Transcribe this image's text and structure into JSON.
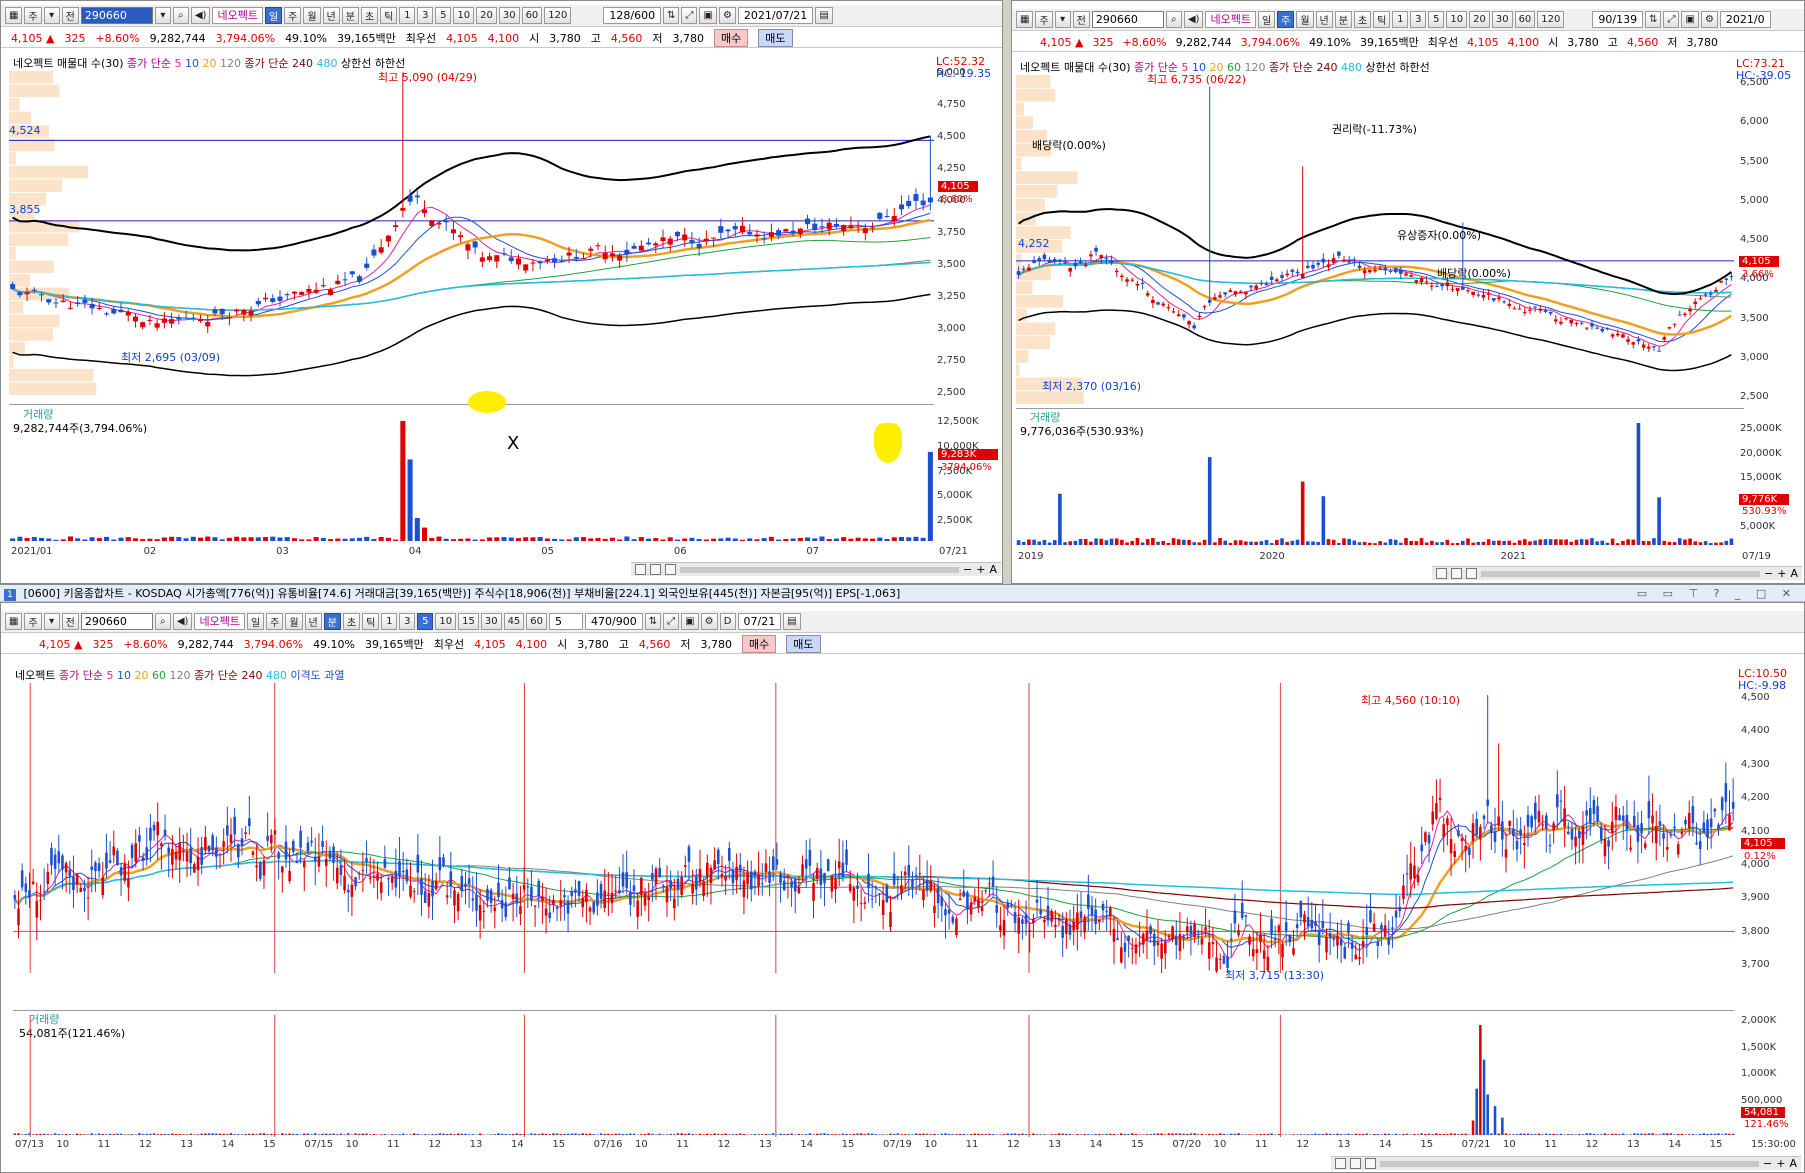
{
  "toolbar": {
    "type_btn": "주",
    "mode_btn": "전",
    "code": "290660",
    "stock_name": "네오펙트",
    "period_tabs": [
      "일",
      "주",
      "월",
      "년",
      "분",
      "초",
      "틱"
    ],
    "numbers": [
      "1",
      "3",
      "5",
      "10",
      "20",
      "30",
      "60",
      "120"
    ],
    "min_numbers": [
      "1",
      "3",
      "5",
      "10",
      "15",
      "30",
      "45",
      "60"
    ]
  },
  "quote": {
    "price": "4,105",
    "arrow": "▲",
    "change": "325",
    "pct": "+8.60%",
    "volume": "9,282,744",
    "vol_pct": "3,794.06%",
    "turnover": "49.10%",
    "amount": "39,165백만",
    "best_label": "최우선",
    "best_ask": "4,105",
    "best_bid": "4,100",
    "open_label": "시",
    "open": "3,780",
    "high_label": "고",
    "high": "4,560",
    "low_label": "저",
    "low": "3,780",
    "buy": "매수",
    "sell": "매도"
  },
  "panel_daily": {
    "count": "128/600",
    "date": "2021/07/21",
    "legend": {
      "title": "네오펙트 매물대 수(30)",
      "ma": "종가 단순",
      "ma5": "5",
      "ma10": "10",
      "ma20": "20",
      "ma120": "120",
      "ma240_label": "종가 단순 240",
      "ma480": "480",
      "upper": "상한선",
      "lower": "하한선"
    },
    "lc": "LC:52.32",
    "hc": "HC:-19.35",
    "high_note": "최고 5,090 (04/29)",
    "low_note": "최저 2,695 (03/09)",
    "hline1": "4,524",
    "hline2": "3,855",
    "price_tag": "4,105",
    "pct_tag": "8.60%",
    "y_labels": [
      "5,000",
      "4,750",
      "4,500",
      "4,250",
      "4,000",
      "3,750",
      "3,500",
      "3,250",
      "3,000",
      "2,750",
      "2,500"
    ],
    "vol_title": "거래량",
    "vol_value": "9,282,744주(3,794.06%)",
    "vol_tag": "9,283K",
    "vol_pct_tag": "3794.06%",
    "mark_x": "X",
    "vol_labels": [
      "12,500K",
      "10,000K",
      "7,500K",
      "5,000K",
      "2,500K"
    ],
    "x_labels": [
      "2021/01",
      "02",
      "03",
      "04",
      "05",
      "06",
      "07",
      "07/21"
    ]
  },
  "panel_weekly": {
    "count": "90/139",
    "date": "2021/0",
    "legend": {
      "title": "네오펙트 매물대 수(30)",
      "ma": "종가 단순",
      "ma5": "5",
      "ma10": "10",
      "ma20": "20",
      "ma60": "60",
      "ma120": "120",
      "ma240_label": "종가 단순 240",
      "ma480": "480",
      "upper": "상한선",
      "lower": "하한선"
    },
    "lc": "LC:73.21",
    "hc": "HC:-39.05",
    "high_note": "최고 6,735 (06/22)",
    "low_note": "최저 2,370 (03/16)",
    "events": [
      "배당락(0.00%)",
      "권리락(-11.73%)",
      "유상증자(0.00%)",
      "배당락(0.00%)"
    ],
    "hline": "4,252",
    "price_tag": "4,105",
    "pct_tag": "3.66%",
    "y_labels": [
      "6,500",
      "6,000",
      "5,500",
      "5,000",
      "4,500",
      "4,000",
      "3,500",
      "3,000",
      "2,500"
    ],
    "vol_title": "거래량",
    "vol_value": "9,776,036주(530.93%)",
    "vol_tag": "9,776K",
    "vol_pct_tag": "530.93%",
    "vol_labels": [
      "25,000K",
      "20,000K",
      "15,000K",
      "10,000K",
      "5,000K"
    ],
    "x_labels": [
      "2019",
      "2020",
      "2021",
      "07/19"
    ]
  },
  "main_header": "[0600] 키움종합차트 - KOSDAQ 시가총액[776(억)] 유통비율[74.6] 거래대금[39,165(백만)] 주식수[18,906(천)] 부채비율[224.1] 외국인보유[445(천)] 자본금[95(억)] EPS[-1,063]",
  "panel_minute": {
    "count": "470/900",
    "min_sel": "5",
    "date": "07/21",
    "d_label": "D",
    "legend": {
      "title": "네오펙트",
      "ma": "종가 단순",
      "ma5": "5",
      "ma10": "10",
      "ma20": "20",
      "ma60": "60",
      "ma120": "120",
      "ma240_label": "종가 단순 240",
      "ma480": "480",
      "disp": "이격도 과열"
    },
    "lc": "LC:10.50",
    "hc": "HC:-9.98",
    "high_note": "최고 4,560 (10:10)",
    "low_note": "최저 3,715 (13:30)",
    "price_tag": "4,105",
    "pct_tag": "0.12%",
    "y_labels": [
      "4,500",
      "4,400",
      "4,300",
      "4,200",
      "4,100",
      "4,000",
      "3,900",
      "3,800",
      "3,700"
    ],
    "vol_title": "거래량",
    "vol_value": "54,081주(121.46%)",
    "vol_tag": "54,081",
    "vol_pct_tag": "121.46%",
    "vol_labels": [
      "2,000K",
      "1,500K",
      "1,000K",
      "500,000"
    ],
    "x_labels": [
      "07/13",
      "10",
      "11",
      "12",
      "13",
      "14",
      "15",
      "07/15",
      "10",
      "11",
      "12",
      "13",
      "14",
      "15",
      "07/16",
      "10",
      "11",
      "12",
      "13",
      "14",
      "15",
      "07/19",
      "10",
      "11",
      "12",
      "13",
      "14",
      "15",
      "07/20",
      "10",
      "11",
      "12",
      "13",
      "14",
      "15",
      "07/21",
      "10",
      "11",
      "12",
      "13",
      "14",
      "15",
      "15:30:00"
    ]
  },
  "colors": {
    "up": "#e00000",
    "down": "#1a50d0",
    "ma5": "#e020a0",
    "ma10": "#1a50d0",
    "ma20": "#f0a020",
    "ma60": "#20a040",
    "ma120": "#808080",
    "ma240": "#800000",
    "ma480": "#20c0e0",
    "band": "#000000"
  }
}
